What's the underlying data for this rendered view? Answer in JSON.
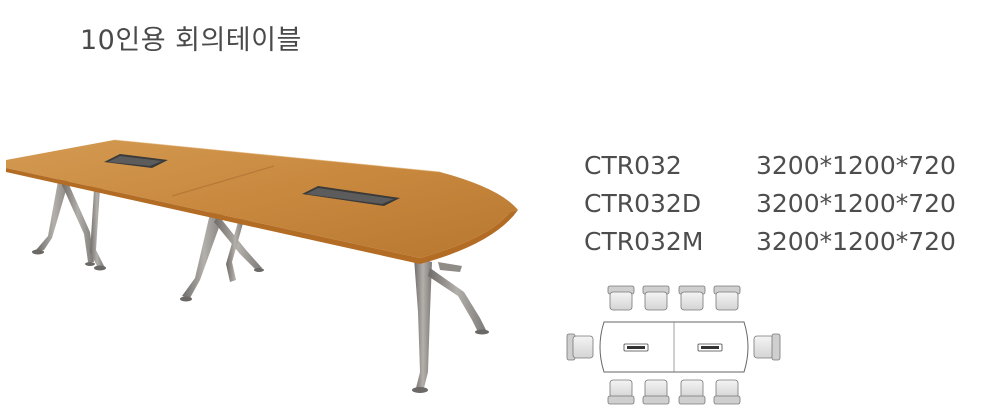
{
  "title": "10인용 회의테이블",
  "models": [
    {
      "code": "CTR032",
      "size": "3200*1200*720"
    },
    {
      "code": "CTR032D",
      "size": "3200*1200*720"
    },
    {
      "code": "CTR032M",
      "size": "3200*1200*720"
    }
  ],
  "colors": {
    "tabletop": "#c8883e",
    "tabletop_edge": "#b26c24",
    "legs": "#8d8985",
    "text": "#4d4d4d"
  },
  "icons": [
    "table-photo",
    "seating-layout-plan",
    "chair-icon",
    "cable-port-icon"
  ]
}
